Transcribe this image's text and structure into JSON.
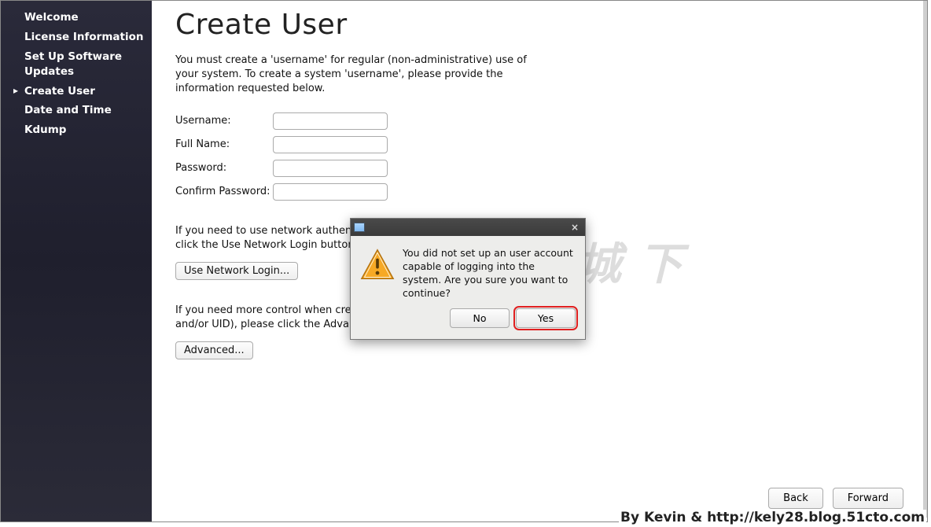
{
  "sidebar": {
    "items": [
      {
        "label": "Welcome"
      },
      {
        "label": "License Information"
      },
      {
        "label": "Set Up Software Updates"
      },
      {
        "label": "Create User"
      },
      {
        "label": "Date and Time"
      },
      {
        "label": "Kdump"
      }
    ]
  },
  "main": {
    "title": "Create User",
    "intro": "You must create a 'username' for regular (non-administrative) use of your system.  To create a system 'username', please provide the information requested below.",
    "fields": {
      "username_label": "Username:",
      "username_value": "",
      "fullname_label": "Full Name:",
      "fullname_value": "",
      "password_label": "Password:",
      "password_value": "",
      "confirm_label": "Confirm Password:",
      "confirm_value": ""
    },
    "network_help": "If you need to use network authentication, such as Kerberos or NIS, please click the Use Network Login button.",
    "network_button": "Use Network Login...",
    "advanced_help": "If you need more control when creating the user (specifying home directory, and/or UID), please click the Advanced button.",
    "advanced_button": "Advanced..."
  },
  "footer": {
    "back": "Back",
    "forward": "Forward"
  },
  "dialog": {
    "message": "You did not set up an user account capable of logging into the system. Are you sure you want to continue?",
    "no": "No",
    "yes": "Yes",
    "close": "×"
  },
  "watermark": {
    "cn": "兵临城下",
    "text": "By Kevin & http://kely28.blog.51cto.com"
  }
}
